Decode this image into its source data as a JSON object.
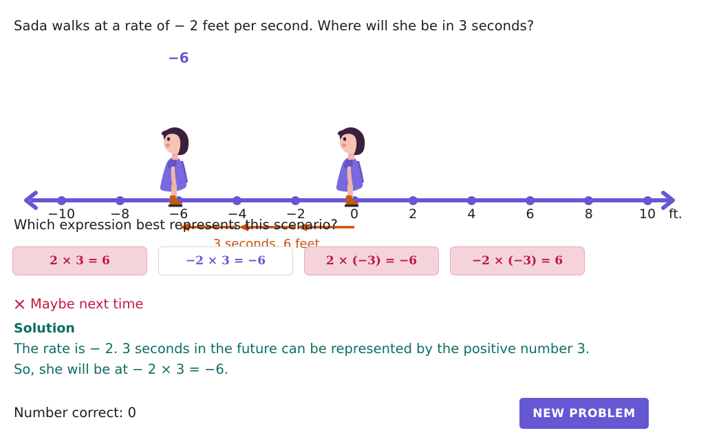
{
  "prompt": "Sada walks at a rate of  − 2 feet per second. Where will she be in 3 seconds?",
  "sub_question": "Which expression best represents this scenario?",
  "number_line": {
    "unit_label": "ft.",
    "tick_labels": [
      "−10",
      "−8",
      "−6",
      "−4",
      "−2",
      "0",
      "2",
      "4",
      "6",
      "8",
      "10"
    ],
    "tick_values": [
      -10,
      -8,
      -6,
      -4,
      -2,
      0,
      2,
      4,
      6,
      8,
      10
    ],
    "min": -10,
    "max": 10,
    "step": 2,
    "axis_color": "#6657d4",
    "left_arrow_icon": "left-arrowhead-icon",
    "right_arrow_icon": "right-arrowhead-icon"
  },
  "markers": {
    "start_value": 0,
    "end_value": -6,
    "end_label": "−6",
    "label_color": "#6657d4"
  },
  "step_arrows": {
    "caption": "3 seconds, 6 feet",
    "color": "#c8500f",
    "segments": [
      {
        "from": 0,
        "to": -2
      },
      {
        "from": -2,
        "to": -4
      },
      {
        "from": -4,
        "to": -6
      }
    ]
  },
  "characters": [
    {
      "name": "girl-at-zero",
      "value": 0
    },
    {
      "name": "girl-at-negative-six",
      "value": -6
    }
  ],
  "choices": [
    {
      "label": "2 × 3 = 6",
      "state": "wrong"
    },
    {
      "label": "−2 × 3 = −6",
      "state": "neutral"
    },
    {
      "label": "2 × (−3) = −6",
      "state": "wrong"
    },
    {
      "label": "−2 × (−3) = 6",
      "state": "wrong"
    }
  ],
  "feedback": {
    "icon": "x-mark-icon",
    "text": "Maybe next time",
    "color": "#c2183c"
  },
  "solution": {
    "heading": "Solution",
    "line1": "The rate is  − 2. 3 seconds in the future can be represented by the positive number 3.",
    "line2": "So, she will be at  − 2 × 3 = −6.",
    "color": "#0b6e62"
  },
  "footer": {
    "score_text": "Number correct: 0",
    "new_problem_label": "NEW PROBLEM",
    "button_color": "#6657d4"
  },
  "palette": {
    "accent": "#6657d4",
    "wrong_bg": "#f4d4da",
    "wrong_border": "#e7a9b5",
    "wrong_text": "#c2183c",
    "orange": "#c8500f",
    "green": "#0b6e62",
    "hair": "#3b1f3e",
    "dress": "#7a68e0",
    "dress_shadow": "#6354c6",
    "skin": "#f2b5a8",
    "boot": "#c35a14"
  }
}
